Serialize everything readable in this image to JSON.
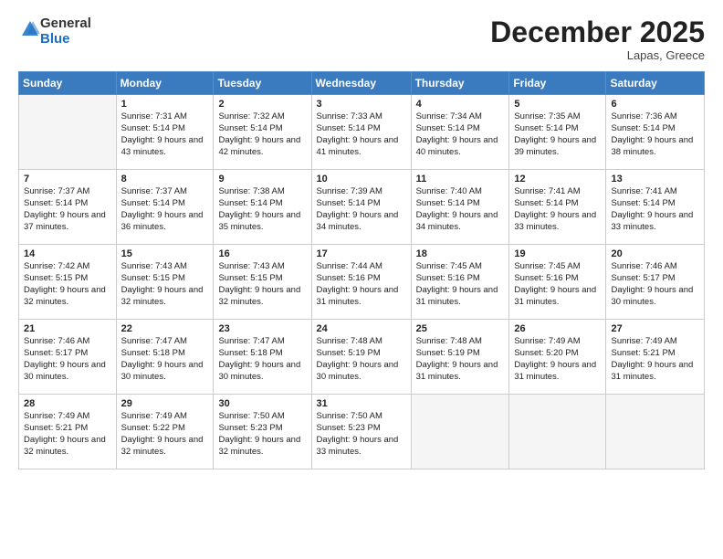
{
  "logo": {
    "general": "General",
    "blue": "Blue"
  },
  "header": {
    "month": "December 2025",
    "location": "Lapas, Greece"
  },
  "weekdays": [
    "Sunday",
    "Monday",
    "Tuesday",
    "Wednesday",
    "Thursday",
    "Friday",
    "Saturday"
  ],
  "weeks": [
    [
      {
        "day": "",
        "empty": true
      },
      {
        "day": "1",
        "sunrise": "7:31 AM",
        "sunset": "5:14 PM",
        "daylight": "9 hours and 43 minutes."
      },
      {
        "day": "2",
        "sunrise": "7:32 AM",
        "sunset": "5:14 PM",
        "daylight": "9 hours and 42 minutes."
      },
      {
        "day": "3",
        "sunrise": "7:33 AM",
        "sunset": "5:14 PM",
        "daylight": "9 hours and 41 minutes."
      },
      {
        "day": "4",
        "sunrise": "7:34 AM",
        "sunset": "5:14 PM",
        "daylight": "9 hours and 40 minutes."
      },
      {
        "day": "5",
        "sunrise": "7:35 AM",
        "sunset": "5:14 PM",
        "daylight": "9 hours and 39 minutes."
      },
      {
        "day": "6",
        "sunrise": "7:36 AM",
        "sunset": "5:14 PM",
        "daylight": "9 hours and 38 minutes."
      }
    ],
    [
      {
        "day": "7",
        "sunrise": "7:37 AM",
        "sunset": "5:14 PM",
        "daylight": "9 hours and 37 minutes."
      },
      {
        "day": "8",
        "sunrise": "7:37 AM",
        "sunset": "5:14 PM",
        "daylight": "9 hours and 36 minutes."
      },
      {
        "day": "9",
        "sunrise": "7:38 AM",
        "sunset": "5:14 PM",
        "daylight": "9 hours and 35 minutes."
      },
      {
        "day": "10",
        "sunrise": "7:39 AM",
        "sunset": "5:14 PM",
        "daylight": "9 hours and 34 minutes."
      },
      {
        "day": "11",
        "sunrise": "7:40 AM",
        "sunset": "5:14 PM",
        "daylight": "9 hours and 34 minutes."
      },
      {
        "day": "12",
        "sunrise": "7:41 AM",
        "sunset": "5:14 PM",
        "daylight": "9 hours and 33 minutes."
      },
      {
        "day": "13",
        "sunrise": "7:41 AM",
        "sunset": "5:14 PM",
        "daylight": "9 hours and 33 minutes."
      }
    ],
    [
      {
        "day": "14",
        "sunrise": "7:42 AM",
        "sunset": "5:15 PM",
        "daylight": "9 hours and 32 minutes."
      },
      {
        "day": "15",
        "sunrise": "7:43 AM",
        "sunset": "5:15 PM",
        "daylight": "9 hours and 32 minutes."
      },
      {
        "day": "16",
        "sunrise": "7:43 AM",
        "sunset": "5:15 PM",
        "daylight": "9 hours and 32 minutes."
      },
      {
        "day": "17",
        "sunrise": "7:44 AM",
        "sunset": "5:16 PM",
        "daylight": "9 hours and 31 minutes."
      },
      {
        "day": "18",
        "sunrise": "7:45 AM",
        "sunset": "5:16 PM",
        "daylight": "9 hours and 31 minutes."
      },
      {
        "day": "19",
        "sunrise": "7:45 AM",
        "sunset": "5:16 PM",
        "daylight": "9 hours and 31 minutes."
      },
      {
        "day": "20",
        "sunrise": "7:46 AM",
        "sunset": "5:17 PM",
        "daylight": "9 hours and 30 minutes."
      }
    ],
    [
      {
        "day": "21",
        "sunrise": "7:46 AM",
        "sunset": "5:17 PM",
        "daylight": "9 hours and 30 minutes."
      },
      {
        "day": "22",
        "sunrise": "7:47 AM",
        "sunset": "5:18 PM",
        "daylight": "9 hours and 30 minutes."
      },
      {
        "day": "23",
        "sunrise": "7:47 AM",
        "sunset": "5:18 PM",
        "daylight": "9 hours and 30 minutes."
      },
      {
        "day": "24",
        "sunrise": "7:48 AM",
        "sunset": "5:19 PM",
        "daylight": "9 hours and 30 minutes."
      },
      {
        "day": "25",
        "sunrise": "7:48 AM",
        "sunset": "5:19 PM",
        "daylight": "9 hours and 31 minutes."
      },
      {
        "day": "26",
        "sunrise": "7:49 AM",
        "sunset": "5:20 PM",
        "daylight": "9 hours and 31 minutes."
      },
      {
        "day": "27",
        "sunrise": "7:49 AM",
        "sunset": "5:21 PM",
        "daylight": "9 hours and 31 minutes."
      }
    ],
    [
      {
        "day": "28",
        "sunrise": "7:49 AM",
        "sunset": "5:21 PM",
        "daylight": "9 hours and 32 minutes."
      },
      {
        "day": "29",
        "sunrise": "7:49 AM",
        "sunset": "5:22 PM",
        "daylight": "9 hours and 32 minutes."
      },
      {
        "day": "30",
        "sunrise": "7:50 AM",
        "sunset": "5:23 PM",
        "daylight": "9 hours and 32 minutes."
      },
      {
        "day": "31",
        "sunrise": "7:50 AM",
        "sunset": "5:23 PM",
        "daylight": "9 hours and 33 minutes."
      },
      {
        "day": "",
        "empty": true
      },
      {
        "day": "",
        "empty": true
      },
      {
        "day": "",
        "empty": true
      }
    ]
  ],
  "labels": {
    "sunrise": "Sunrise:",
    "sunset": "Sunset:",
    "daylight": "Daylight:"
  }
}
